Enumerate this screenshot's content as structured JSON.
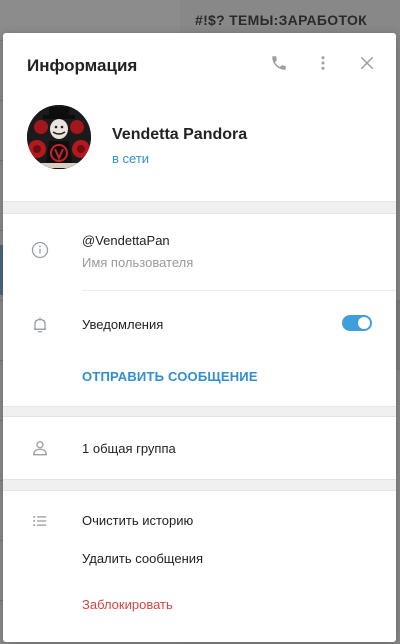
{
  "background": {
    "chat_title": "#!$? ТЕМЫ:ЗАРАБОТОК"
  },
  "modal": {
    "title": "Информация",
    "profile": {
      "name": "Vendetta Pandora",
      "status": "в сети"
    },
    "info": {
      "username": "@VendettaPan",
      "username_caption": "Имя пользователя",
      "notifications_label": "Уведомления",
      "notifications_enabled": true,
      "send_message_label": "ОТПРАВИТЬ СООБЩЕНИЕ"
    },
    "groups": {
      "common_groups_label": "1 общая группа"
    },
    "actions": {
      "clear_history": "Очистить историю",
      "delete_messages": "Удалить сообщения",
      "block": "Заблокировать"
    }
  },
  "colors": {
    "accent": "#2f8fd0",
    "toggle_on": "#3f9edb",
    "danger": "#d64545",
    "separator": "#f0f0f0"
  },
  "icons": {
    "call": "phone-icon",
    "more": "more-vertical-icon",
    "close": "close-icon",
    "info": "info-icon",
    "notifications": "bell-icon",
    "groups": "user-icon",
    "actions": "list-icon"
  }
}
